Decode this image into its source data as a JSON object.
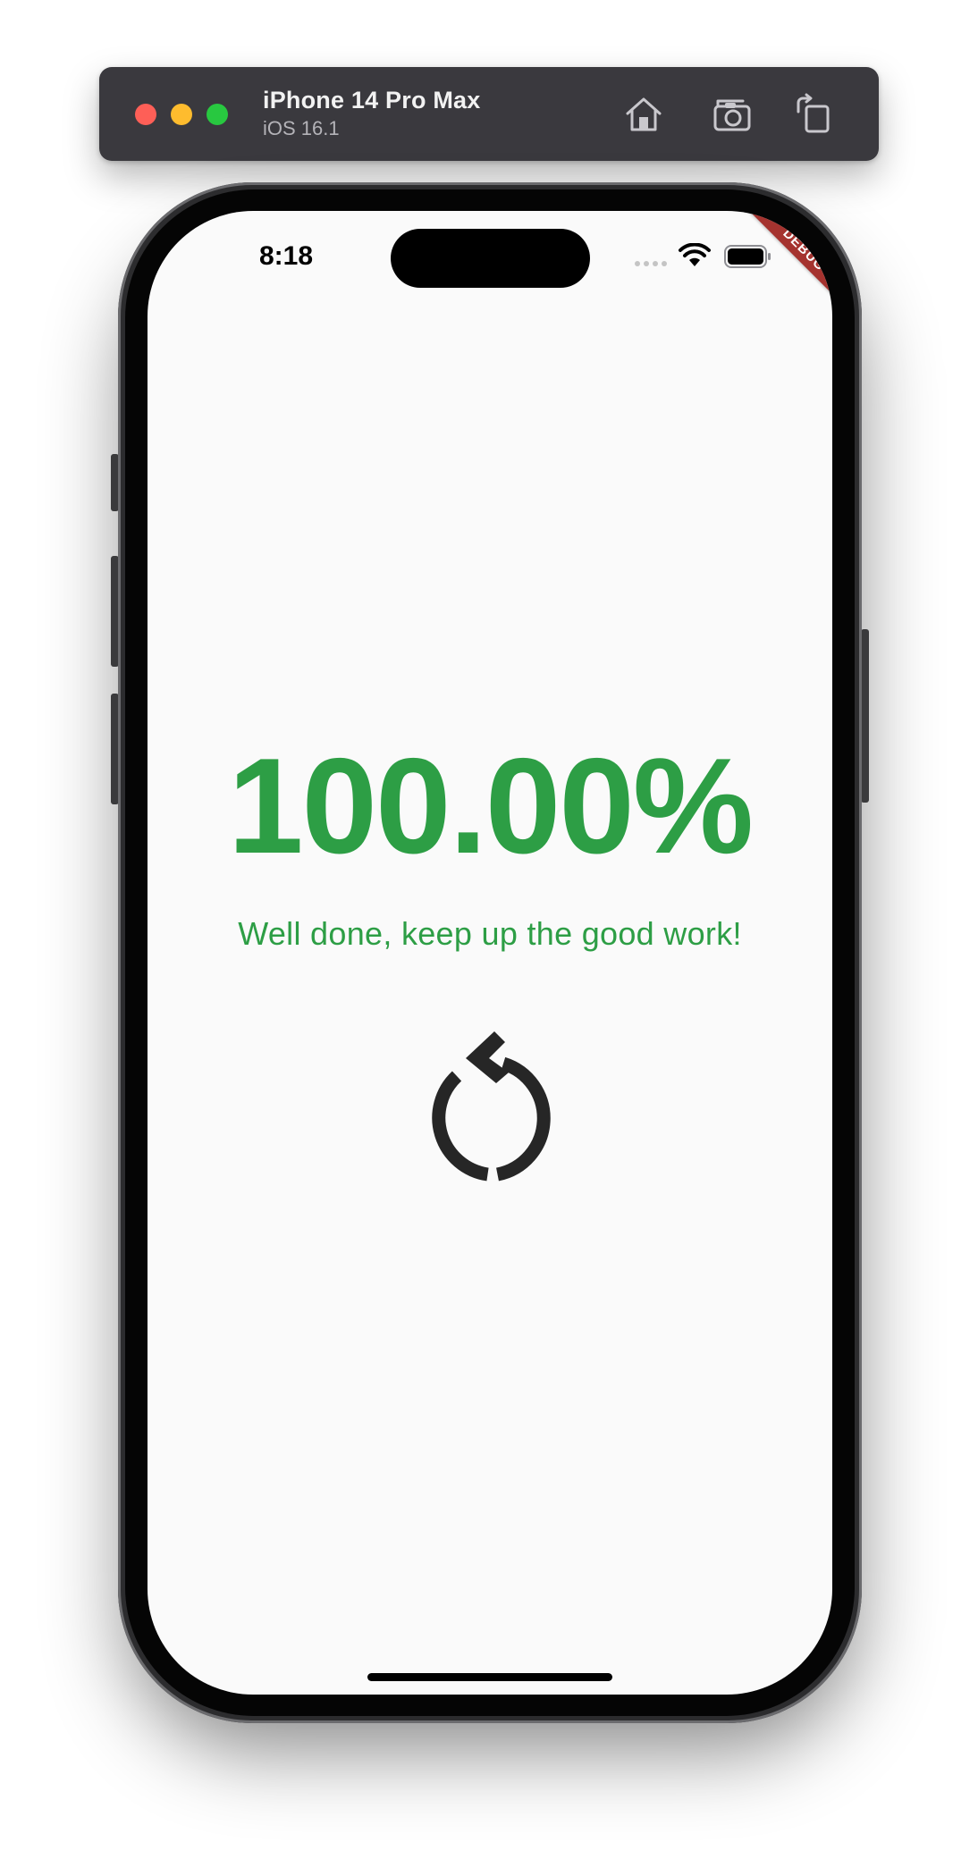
{
  "toolbar": {
    "device_name": "iPhone 14 Pro Max",
    "os_version": "iOS 16.1",
    "icons": [
      "home-icon",
      "screenshot-icon",
      "rotate-icon"
    ]
  },
  "status_bar": {
    "time": "8:18",
    "icons": [
      "cellular-signal-icon",
      "wifi-icon",
      "battery-icon"
    ]
  },
  "debug_banner": "DEBUG",
  "result": {
    "percentage": "100.00%",
    "message": "Well done, keep up the good work!",
    "restart_icon": "restart-icon"
  },
  "colors": {
    "accent_green": "#2d9e45",
    "screen_background": "#fafafa",
    "debug_red": "#a5332f",
    "toolbar_background": "#3a393e"
  }
}
